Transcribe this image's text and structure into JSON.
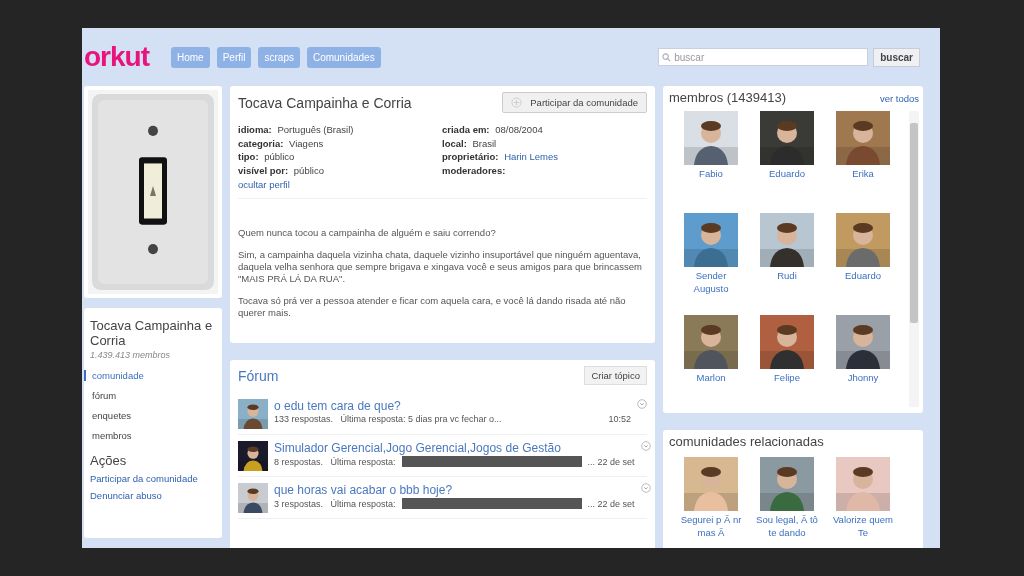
{
  "logo": "orkut",
  "nav": [
    {
      "label": "Home"
    },
    {
      "label": "Perfil"
    },
    {
      "label": "scraps"
    },
    {
      "label": "Comunidades"
    }
  ],
  "search": {
    "placeholder": "buscar",
    "button": "buscar"
  },
  "community": {
    "title": "Tocava Campainha e Corria",
    "member_count": "1.439.413 membros",
    "menu": [
      {
        "label": "comunidade",
        "selected": true
      },
      {
        "label": "fórum",
        "selected": false
      },
      {
        "label": "enquetes",
        "selected": false
      },
      {
        "label": "membros",
        "selected": false
      }
    ],
    "actions_title": "Ações",
    "actions": [
      "Participar da comunidade",
      "Denunciar abuso"
    ]
  },
  "profile": {
    "title": "Tocava Campainha e Corria",
    "join_button": "Participar da comunidade",
    "fields_left": [
      {
        "label": "idioma:",
        "value": "Português (Brasil)",
        "kind": "text"
      },
      {
        "label": "categoria:",
        "value": "Viagens",
        "kind": "text"
      },
      {
        "label": "tipo:",
        "value": "público",
        "kind": "text"
      },
      {
        "label": "visível por:",
        "value": "público",
        "kind": "text"
      }
    ],
    "fields_right": [
      {
        "label": "criada em:",
        "value": "08/08/2004",
        "kind": "text"
      },
      {
        "label": "local:",
        "value": "Brasil",
        "kind": "text"
      },
      {
        "label": "proprietário:",
        "value": "Harin Lemes",
        "kind": "link"
      },
      {
        "label": "moderadores:",
        "kind": "text"
      }
    ],
    "hide_link": "ocultar perfil",
    "description": [
      "Quem nunca tocou a campainha de alguém e saiu correndo?",
      "Sim, a campainha daquela vizinha chata, daquele vizinho insuportável que ninguém aguentava, daquela velha senhora que sempre brigava e xingava você e seus amigos para que brincassem \"MAIS PRÁ LÁ DA RUA\".",
      "Tocava só prá ver a pessoa atender e ficar com aquela cara, e você lá dando risada até não querer mais."
    ]
  },
  "forum": {
    "title": "Fórum",
    "button": "Criar tópico",
    "topics": [
      {
        "title": "o edu tem cara de que?",
        "meta": "133 respostas.   Última resposta: 5 dias pra vc fechar o...",
        "redacted": false,
        "time": "10:52"
      },
      {
        "title": "Simulador Gerencial,Jogo Gerencial,Jogos de Gestão",
        "meta": "8 respostas.   Última resposta:",
        "redacted": true,
        "time": "... 22 de set"
      },
      {
        "title": "que horas vai acabar o bbb hoje?",
        "meta": "3 respostas.   Última resposta:",
        "redacted": true,
        "time": "... 22 de set"
      }
    ]
  },
  "members": {
    "title": "membros (1439413)",
    "link": "ver todos",
    "people": [
      {
        "name": "Fabio"
      },
      {
        "name": "Eduardo"
      },
      {
        "name": "Erika"
      },
      {
        "name": "Sender Augusto"
      },
      {
        "name": "Rudi"
      },
      {
        "name": "Eduardo"
      },
      {
        "name": "Marlon"
      },
      {
        "name": "Felipe"
      },
      {
        "name": "Jhonny"
      }
    ]
  },
  "related": {
    "title": "comunidades relacionadas",
    "items": [
      {
        "name": "Segurei p Ã nr mas Ã"
      },
      {
        "name": "Sou legal, Ã tô te dando"
      },
      {
        "name": "Valorize quem Te"
      }
    ]
  }
}
